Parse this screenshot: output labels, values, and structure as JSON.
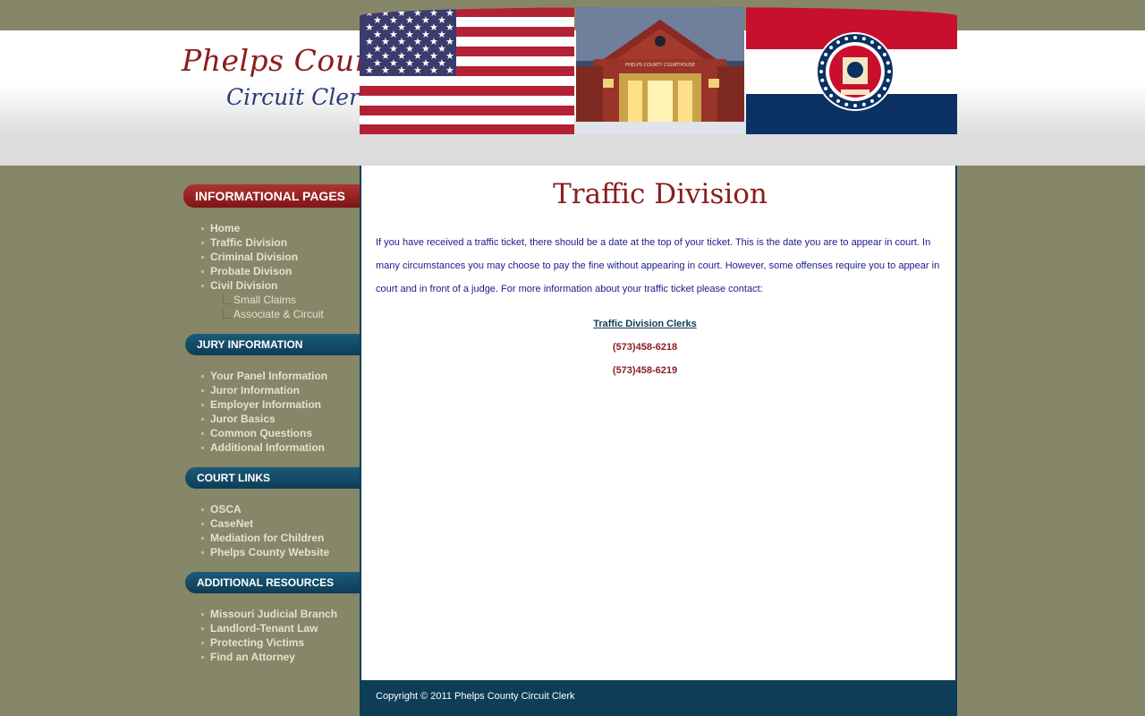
{
  "header": {
    "site_name_line1": "Phelps County",
    "site_name_line2": "Circuit Clerk",
    "banner_building_sign": "PHELPS COUNTY COURTHOUSE"
  },
  "sidebar": {
    "sections": [
      {
        "title": "INFORMATIONAL PAGES",
        "items": [
          "Home",
          "Traffic Division",
          "Criminal Division",
          "Probate Divison",
          "Civil Division"
        ],
        "subitems": [
          "Small Claims",
          "Associate & Circuit"
        ]
      },
      {
        "title": "JURY INFORMATION",
        "items": [
          "Your Panel Information",
          "Juror Information",
          "Employer Information",
          "Juror Basics",
          "Common Questions",
          "Additional Information"
        ]
      },
      {
        "title": "COURT LINKS",
        "items": [
          "OSCA",
          "CaseNet",
          "Mediation for Children",
          "Phelps County Website"
        ]
      },
      {
        "title": "ADDITIONAL RESOURCES",
        "items": [
          "Missouri Judicial Branch",
          "Landlord-Tenant Law",
          "Protecting Victims",
          "Find an Attorney"
        ]
      }
    ]
  },
  "main": {
    "title": "Traffic Division",
    "intro": "If you have received a traffic ticket, there should be a date at the top of your ticket. This is the date you are to appear in court. In many circumstances you may choose to pay the fine without appearing in court. However, some offenses require you to appear in court and in front of a judge. For more information about your traffic ticket please contact:",
    "contact_link": "Traffic Division Clerks",
    "phones": [
      "(573)458-6218",
      "(573)458-6219"
    ]
  },
  "footer": {
    "copyright": "Copyright © 2011 Phelps County Circuit Clerk"
  },
  "colors": {
    "page_bg": "#868668",
    "accent_red": "#8b1c1c",
    "accent_blue": "#0d3d57",
    "body_text": "#1a1a8c"
  }
}
